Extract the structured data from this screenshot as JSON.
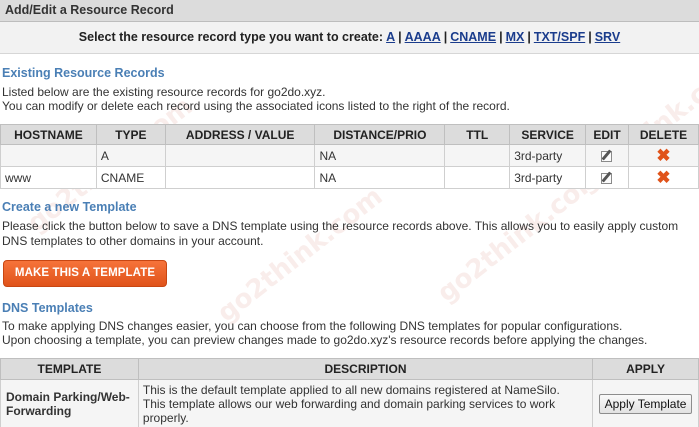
{
  "header": {
    "title": "Add/Edit a Resource Record"
  },
  "selector": {
    "prompt": "Select the resource record type you want to create:",
    "types": [
      "A",
      "AAAA",
      "CNAME",
      "MX",
      "TXT/SPF",
      "SRV"
    ],
    "separator": "|"
  },
  "existing": {
    "title": "Existing Resource Records",
    "line1": "Listed below are the existing resource records for go2do.xyz.",
    "line2": "You can modify or delete each record using the associated icons listed to the right of the record.",
    "columns": [
      "HOSTNAME",
      "TYPE",
      "ADDRESS / VALUE",
      "DISTANCE/PRIO",
      "TTL",
      "SERVICE",
      "EDIT",
      "DELETE"
    ],
    "rows": [
      {
        "hostname": "",
        "type": "A",
        "value": "",
        "distance": "NA",
        "ttl": "",
        "service": "3rd-party"
      },
      {
        "hostname": "www",
        "type": "CNAME",
        "value": "",
        "distance": "NA",
        "ttl": "",
        "service": "3rd-party"
      }
    ],
    "edit_icon": "edit-icon",
    "delete_icon": "delete-icon",
    "delete_glyph": "✖"
  },
  "create_template": {
    "title": "Create a new Template",
    "line1": "Please click the button below to save a DNS template using the resource records above. This allows you to easily apply custom",
    "line2": "DNS templates to other domains in your account.",
    "button_label": "MAKE THIS A TEMPLATE"
  },
  "dns_templates": {
    "title": "DNS Templates",
    "line1": "To make applying DNS changes easier, you can choose from the following DNS templates for popular configurations.",
    "line2": "Upon choosing a template, you can preview changes made to go2do.xyz's resource records before applying the changes.",
    "columns": [
      "TEMPLATE",
      "DESCRIPTION",
      "APPLY"
    ],
    "rows": [
      {
        "name_line1": "Domain Parking/Web-",
        "name_line2": "Forwarding",
        "desc_line1": "This is the default template applied to all new domains registered at NameSilo.",
        "desc_line2": "This template allows our web forwarding and domain parking services to work",
        "desc_line3": "properly.",
        "apply_label": "Apply Template"
      }
    ]
  },
  "watermark": "go2think.com",
  "colors": {
    "accent_orange": "#e0531a",
    "section_blue": "#4a7fb5",
    "link_blue": "#1a3c8c",
    "header_gray": "#dcdcdc"
  }
}
